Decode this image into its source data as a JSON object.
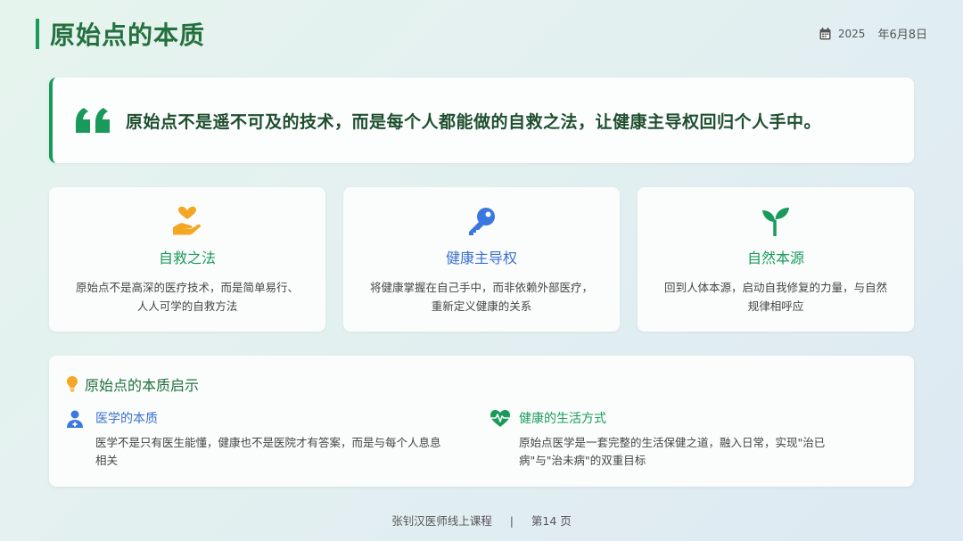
{
  "header": {
    "title": "原始点的本质",
    "date_year": "2025",
    "date_rest": "年6月8日"
  },
  "quote": {
    "text": "原始点不是遥不可及的技术，而是每个人都能做的自救之法，让健康主导权回归个人手中。"
  },
  "features": [
    {
      "icon": "hand-heart-icon",
      "title": "自救之法",
      "desc_line1": "原始点不是高深的医疗技术，而是简单易行、",
      "desc_line2": "人人可学的自救方法"
    },
    {
      "icon": "key-icon",
      "title": "健康主导权",
      "desc_line1": "将健康掌握在自己手中，而非依赖外部医疗，",
      "desc_line2": "重新定义健康的关系"
    },
    {
      "icon": "sprout-icon",
      "title": "自然本源",
      "desc_line1": "回到人体本源，启动自我修复的力量，与自然",
      "desc_line2": "规律相呼应"
    }
  ],
  "essence": {
    "title": "原始点的本质启示",
    "points": [
      {
        "icon": "doctor-icon",
        "title": "医学的本质",
        "desc_line1": "医学不是只有医生能懂，健康也不是医院才有答案，而是与每个人息息",
        "desc_line2": "相关"
      },
      {
        "icon": "heartbeat-icon",
        "title": "健康的生活方式",
        "desc_line1": "原始点医学是一套完整的生活保健之道，融入日常，实现\"治已",
        "desc_line2": "病\"与\"治未病\"的双重目标"
      }
    ]
  },
  "footer": {
    "course": "张钊汉医师线上课程",
    "separator": "|",
    "page": "第14 页"
  },
  "colors": {
    "accent_green": "#1a9a5a",
    "accent_blue": "#3a6fce",
    "icon_orange": "#f5a623"
  }
}
